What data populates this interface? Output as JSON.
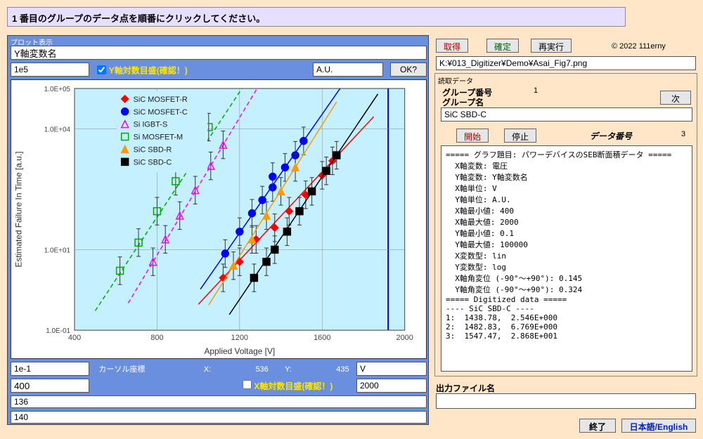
{
  "banner": "1  番目のグループのデータ点を順番にクリックしてください。",
  "plot_panel_title": "プロット表示",
  "y_var_name": "Y軸変数名",
  "y_max": "1e5",
  "y_log_label": "Y軸対数目盛(確認！)",
  "y_unit": "A.U.",
  "ok_label": "OK?",
  "y_min": "1e-1",
  "cursor_label": "カーソル座標",
  "cursor_x_label": "X:",
  "cursor_x": "536",
  "cursor_y_label": "Y:",
  "cursor_y": "435",
  "x_unit": "V",
  "x_min": "400",
  "x_log_label": "X軸対数目盛(確認！)",
  "x_max": "2000",
  "val136": "136",
  "val140": "140",
  "btn_acquire": "取得",
  "btn_confirm": "確定",
  "btn_rerun": "再実行",
  "copyright": "© 2022 111erny",
  "file_path": "K:¥013_Digitizer¥Demo¥Asai_Fig7.png",
  "read_panel_title": "読取データ",
  "group_index_label": "グループ番号",
  "group_index": "1",
  "group_name_label": "グループ名",
  "btn_next": "次",
  "group_name": "SiC SBD-C",
  "btn_start": "開始",
  "btn_stop": "停止",
  "data_index_label": "データ番号",
  "data_index": "3",
  "log_text": "===== グラフ題目: パワーデバイスのSEB断面積データ =====\n  X軸変数: 電圧\n  Y軸変数: Y軸変数名\n  X軸単位: V\n  Y軸単位: A.U.\n  X軸最小値: 400\n  X軸最大値: 2000\n  Y軸最小値: 0.1\n  Y軸最大値: 100000\n  X変数型: lin\n  Y変数型: log\n  X軸角変位 (-90°～+90°): 0.145\n  Y軸角変位 (-90°～+90°): 0.324\n===== Digitized data =====\n---- SiC SBD-C ----\n1:  1438.78,  2.546E+000\n2:  1482.83,  6.769E+000\n3:  1547.47,  2.868E+001",
  "output_file_label": "出力ファイル名",
  "btn_exit": "終了",
  "btn_lang": "日本語/English",
  "chart_data": {
    "type": "scatter",
    "title": "",
    "xlabel": "Applied Voltage  [V]",
    "ylabel": "Estimated Failure In Time  [a.u.]",
    "xlim": [
      400,
      2000
    ],
    "ylim": [
      0.1,
      100000
    ],
    "yscale": "log",
    "x_ticks": [
      400,
      800,
      1200,
      1600,
      2000
    ],
    "y_ticks": [
      0.1,
      10,
      10000,
      100000
    ],
    "y_tick_labels": [
      "1.0E-01",
      "1.0E+01",
      "1.0E+04",
      "1.0E+05"
    ],
    "series": [
      {
        "name": "SiC MOSFET-R",
        "marker": "diamond",
        "fill": "#ff0000",
        "line": "#ff0000",
        "points": [
          [
            1120,
            2
          ],
          [
            1200,
            5
          ],
          [
            1280,
            18
          ],
          [
            1370,
            35
          ],
          [
            1440,
            90
          ],
          [
            1520,
            230
          ],
          [
            1600,
            700
          ],
          [
            1650,
            1600
          ]
        ]
      },
      {
        "name": "SiC MOSFET-C",
        "marker": "circle",
        "fill": "#0000ff",
        "line": "#0000ff",
        "points": [
          [
            1130,
            8
          ],
          [
            1200,
            28
          ],
          [
            1260,
            80
          ],
          [
            1310,
            170
          ],
          [
            1360,
            350
          ],
          [
            1360,
            650
          ],
          [
            1420,
            1100
          ],
          [
            1470,
            2200
          ],
          [
            1510,
            5000
          ]
        ]
      },
      {
        "name": "Si IGBT-S",
        "marker": "triangle",
        "fill": "none",
        "stroke": "#ff00ff",
        "line": "#ff00ff",
        "points": [
          [
            780,
            5
          ],
          [
            840,
            18
          ],
          [
            910,
            70
          ],
          [
            985,
            300
          ],
          [
            1060,
            1200
          ],
          [
            1120,
            4000
          ]
        ]
      },
      {
        "name": "Si MOSFET-M",
        "marker": "square",
        "fill": "none",
        "stroke": "#00aa00",
        "line": "#00aa00",
        "points": [
          [
            620,
            3
          ],
          [
            710,
            15
          ],
          [
            800,
            90
          ],
          [
            890,
            500
          ],
          [
            980,
            2800
          ],
          [
            1050,
            11000
          ]
        ]
      },
      {
        "name": "SiC SBD-R",
        "marker": "triangle",
        "fill": "#ff9900",
        "line": "#ff9900",
        "points": [
          [
            1170,
            4
          ],
          [
            1260,
            18
          ],
          [
            1330,
            70
          ],
          [
            1400,
            280
          ],
          [
            1470,
            1100
          ]
        ]
      },
      {
        "name": "SiC SBD-C",
        "marker": "square",
        "fill": "#000000",
        "line": "#000000",
        "points": [
          [
            1270,
            2
          ],
          [
            1330,
            5
          ],
          [
            1370,
            10
          ],
          [
            1430,
            28
          ],
          [
            1490,
            90
          ],
          [
            1550,
            280
          ],
          [
            1620,
            900
          ],
          [
            1670,
            2200
          ]
        ]
      }
    ]
  }
}
